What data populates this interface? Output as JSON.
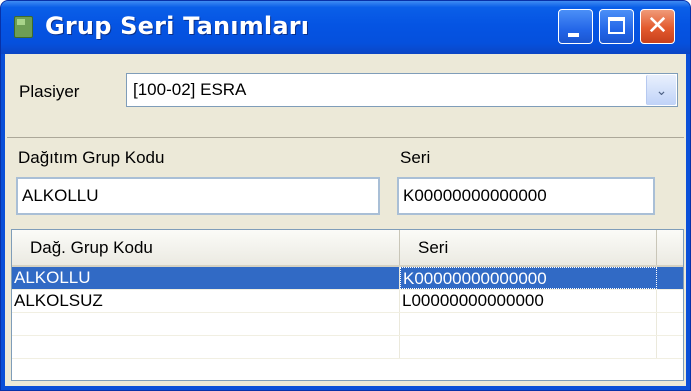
{
  "window": {
    "title": "Grup Seri Tanımları",
    "minimize_icon": "minimize-icon",
    "maximize_icon": "maximize-icon",
    "close_glyph": "✕"
  },
  "form": {
    "plasiyer_label": "Plasiyer",
    "plasiyer_value": "[100-02] ESRA",
    "dropdown_arrow": "⌄",
    "group_code_label": "Dağıtım Grup Kodu",
    "group_code_value": "ALKOLLU",
    "serie_label": "Seri",
    "serie_value": "K00000000000000"
  },
  "grid": {
    "columns": [
      "Dağ. Grup Kodu",
      "Seri"
    ],
    "rows": [
      {
        "code": "ALKOLLU",
        "serie": "K00000000000000",
        "selected": true
      },
      {
        "code": "ALKOLSUZ",
        "serie": "L00000000000000",
        "selected": false
      }
    ]
  },
  "colors": {
    "titlebar": "#0554e3",
    "selection": "#316ac5",
    "client_bg": "#ece9d8"
  }
}
